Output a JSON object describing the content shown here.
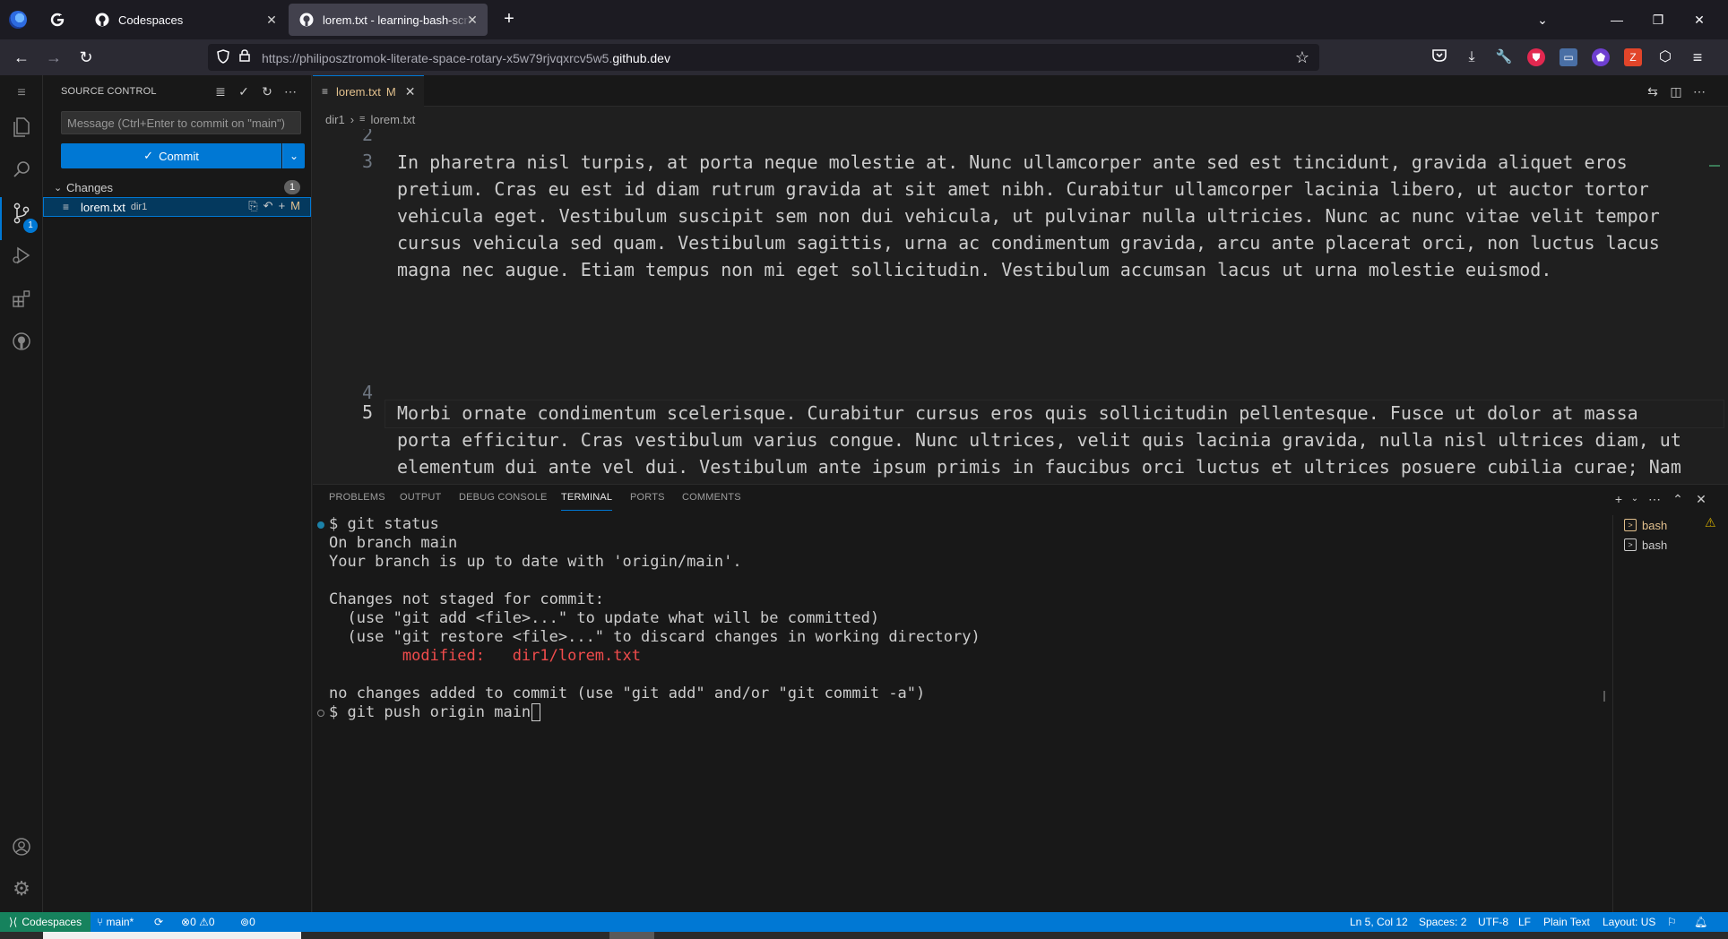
{
  "browser": {
    "tabs": [
      {
        "label": "",
        "icon": "google-icon"
      },
      {
        "label": "Codespaces",
        "icon": "github-icon"
      },
      {
        "label": "lorem.txt - learning-bash-scripts",
        "icon": "github-icon",
        "active": true
      }
    ],
    "url_prefix": "https://philiposztromok-literate-space-rotary-x5w79rjvqxrcv5w5.",
    "url_domain": "github.dev",
    "extension_badge": "6"
  },
  "activity_bar": {
    "items": [
      "explorer-icon",
      "search-icon",
      "source-control-icon",
      "run-debug-icon",
      "extensions-icon",
      "github-icon"
    ],
    "scm_badge": "1",
    "bottom": [
      "accounts-icon",
      "manage-icon"
    ]
  },
  "sidebar": {
    "title": "SOURCE CONTROL",
    "message_placeholder": "Message (Ctrl+Enter to commit on \"main\")",
    "commit_label": "Commit",
    "changes_label": "Changes",
    "changes_count": "1",
    "file": {
      "name": "lorem.txt",
      "dir": "dir1",
      "status": "M"
    }
  },
  "editor": {
    "tab": {
      "name": "lorem.txt",
      "status": "M"
    },
    "breadcrumb": [
      "dir1",
      "lorem.txt"
    ],
    "lines": [
      {
        "num": "2",
        "text": ""
      },
      {
        "num": "3",
        "text": "In pharetra nisl turpis, at porta neque molestie at. Nunc ullamcorper ante sed est tincidunt, gravida aliquet eros pretium. Cras eu est id diam rutrum gravida at sit amet nibh. Curabitur ullamcorper lacinia libero, ut auctor tortor vehicula eget. Vestibulum suscipit sem non dui vehicula, ut pulvinar nulla ultricies. Nunc ac nunc vitae velit tempor cursus vehicula sed quam. Vestibulum sagittis, urna ac condimentum gravida, arcu ante placerat orci, non luctus lacus magna nec augue. Etiam tempus non mi eget sollicitudin. Vestibulum accumsan lacus ut urna molestie euismod."
      },
      {
        "num": "4",
        "text": ""
      },
      {
        "num": "5",
        "text": "Morbi ornate condimentum scelerisque. Curabitur cursus eros quis sollicitudin pellentesque. Fusce ut dolor at massa porta efficitur. Cras vestibulum varius congue. Nunc ultrices, velit quis lacinia gravida, nulla nisl ultrices diam, ut elementum dui ante vel dui. Vestibulum ante ipsum primis in faucibus orci luctus et ultrices posuere cubilia curae; Nam vel ipsum tempor, vestibulum purus eget, sagittis augue. Interdum et malesuada fames ac ante ipsum primis in faucibus. Morbi nec risus tellus. Quisque molestie porttitor feugiat. Fusce risus risus, venenatis et lacinia ut, eleifend ac magna. Aenean cursus, magna id euismod sollicitudin, diam urna tincidunt"
      }
    ]
  },
  "panel": {
    "tabs": [
      "PROBLEMS",
      "OUTPUT",
      "DEBUG CONSOLE",
      "TERMINAL",
      "PORTS",
      "COMMENTS"
    ],
    "active_tab": "TERMINAL",
    "terminal_lines": [
      "$ git status",
      "On branch main",
      "Your branch is up to date with 'origin/main'.",
      "",
      "Changes not staged for commit:",
      "  (use \"git add <file>...\" to update what will be committed)",
      "  (use \"git restore <file>...\" to discard changes in working directory)",
      "        modified:   dir1/lorem.txt",
      "",
      "no changes added to commit (use \"git add\" and/or \"git commit -a\")",
      "$ git push origin main"
    ],
    "terminals": [
      "bash",
      "bash"
    ]
  },
  "status_bar": {
    "remote": "Codespaces",
    "branch": "main*",
    "errors": "0",
    "warnings": "0",
    "ports": "0",
    "cursor_pos": "Ln 5, Col 12",
    "spaces": "Spaces: 2",
    "encoding": "UTF-8",
    "eol": "LF",
    "language": "Plain Text",
    "layout": "Layout: US"
  }
}
